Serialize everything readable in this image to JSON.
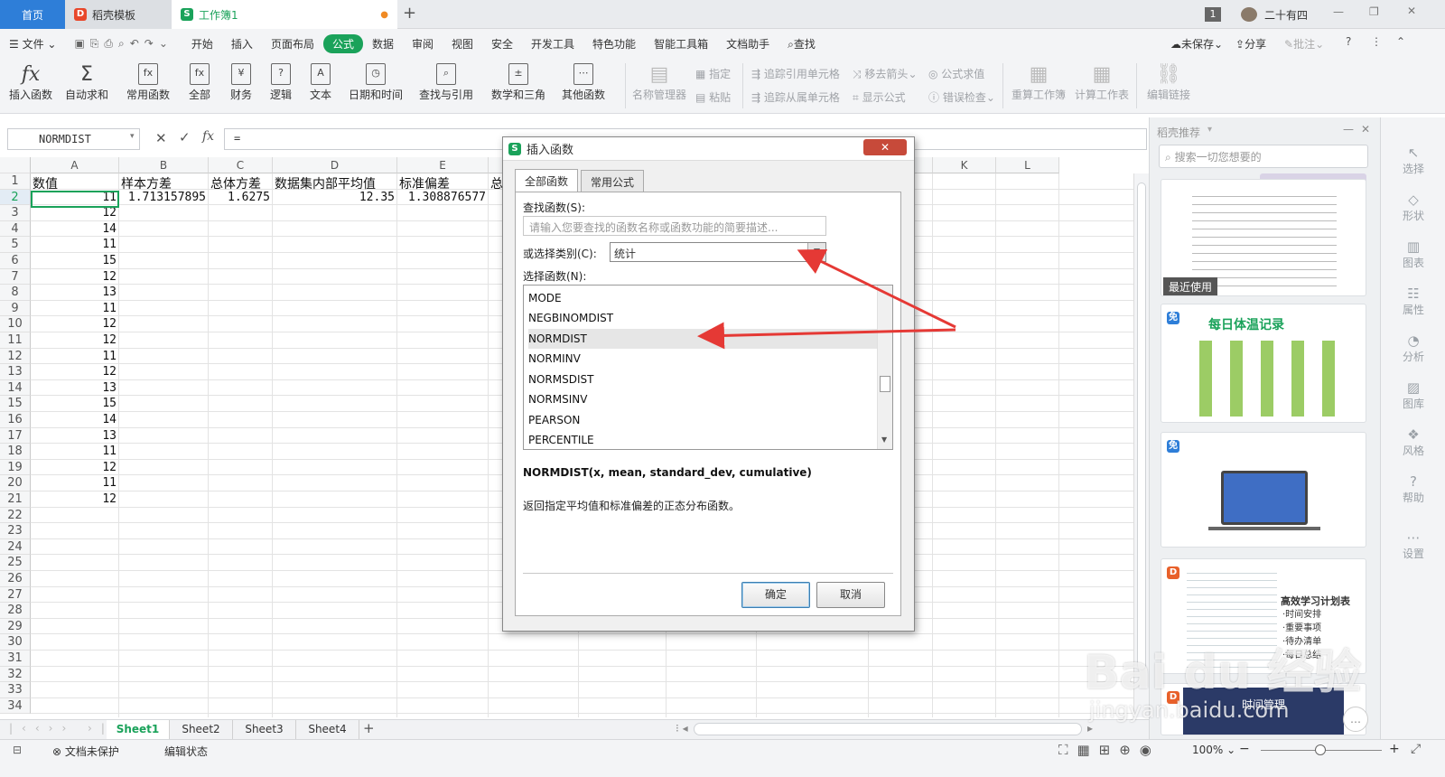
{
  "tabs": {
    "home": "首页",
    "template": "稻壳模板",
    "workbook": "工作簿1",
    "new_tab": "+"
  },
  "titlebar_right": {
    "badge": "1",
    "user": "二十有四"
  },
  "menu": {
    "file": "文件",
    "items": [
      "开始",
      "插入",
      "页面布局",
      "公式",
      "数据",
      "审阅",
      "视图",
      "安全",
      "开发工具",
      "特色功能",
      "智能工具箱",
      "文档助手"
    ],
    "active": "公式",
    "search": "查找",
    "unsaved": "未保存",
    "share": "分享",
    "annotate": "批注"
  },
  "ribbon": {
    "insert_fn": "插入函数",
    "autosum": "自动求和",
    "common": "常用函数",
    "all": "全部",
    "finance": "财务",
    "logic": "逻辑",
    "text": "文本",
    "datetime": "日期和时间",
    "lookup": "查找与引用",
    "math": "数学和三角",
    "other": "其他函数",
    "name_mgr": "名称管理器",
    "specify": "指定",
    "paste": "粘贴",
    "trace_prec": "追踪引用单元格",
    "trace_dep": "追踪从属单元格",
    "remove_arrows": "移去箭头",
    "show_formula": "显示公式",
    "eval": "公式求值",
    "error_check": "错误检查",
    "recalc": "重算工作簿",
    "calc_sheet": "计算工作表",
    "edit_links": "编辑链接"
  },
  "formula_bar": {
    "name_box": "NORMDIST",
    "content": "="
  },
  "columns": [
    "A",
    "B",
    "C",
    "D",
    "E",
    "F",
    "G",
    "H",
    "I",
    "J",
    "K",
    "L"
  ],
  "rows": [
    "1",
    "2",
    "3",
    "4",
    "5",
    "6",
    "7",
    "8",
    "9",
    "10",
    "11",
    "12",
    "13",
    "14",
    "15",
    "16",
    "17",
    "18",
    "19",
    "20",
    "21",
    "22",
    "23",
    "24",
    "25",
    "26",
    "27",
    "28",
    "29",
    "30",
    "31",
    "32",
    "33",
    "34"
  ],
  "header_row": [
    "数值",
    "样本方差",
    "总体方差",
    "数据集内部平均值",
    "标准偏差",
    "总"
  ],
  "row2": {
    "b": "1.713157895",
    "c": "1.6275",
    "d": "12.35",
    "e": "1.308876577"
  },
  "col_a_values": [
    "11",
    "12",
    "14",
    "11",
    "15",
    "12",
    "13",
    "11",
    "12",
    "12",
    "11",
    "12",
    "13",
    "15",
    "14",
    "13",
    "11",
    "12",
    "11",
    "12"
  ],
  "sheets": [
    "Sheet1",
    "Sheet2",
    "Sheet3",
    "Sheet4"
  ],
  "status": {
    "protect": "文档未保护",
    "edit_state": "编辑状态",
    "zoom": "100%"
  },
  "panel": {
    "title": "稻壳推荐",
    "search_placeholder": "搜索一切您想要的",
    "recent": "最近使用",
    "free": "免",
    "card2_title": "每日体温记录",
    "card4_title": "高效学习计划表",
    "card4_items": [
      "·时间安排",
      "·重要事项",
      "·待办清单",
      "·每日总结"
    ],
    "card5_title": "时间管理"
  },
  "rail": [
    "选择",
    "形状",
    "图表",
    "属性",
    "分析",
    "图库",
    "风格",
    "帮助",
    "设置"
  ],
  "dialog": {
    "title": "插入函数",
    "close": "✕",
    "tab_all": "全部函数",
    "tab_common": "常用公式",
    "search_label": "查找函数(S):",
    "search_placeholder": "请输入您要查找的函数名称或函数功能的简要描述...",
    "category_label": "或选择类别(C):",
    "category_value": "统计",
    "list_label": "选择函数(N):",
    "functions": [
      "MODE",
      "NEGBINOMDIST",
      "NORMDIST",
      "NORMINV",
      "NORMSDIST",
      "NORMSINV",
      "PEARSON",
      "PERCENTILE"
    ],
    "selected": "NORMDIST",
    "signature": "NORMDIST(x, mean, standard_dev, cumulative)",
    "description": "返回指定平均值和标准偏差的正态分布函数。",
    "ok": "确定",
    "cancel": "取消"
  },
  "watermark": {
    "brand": "Bai du 经验",
    "url": "jingyan.baidu.com"
  },
  "colors": {
    "accent": "#1aa25a",
    "home_tab": "#2e7ed8",
    "arrow": "#e53935"
  }
}
